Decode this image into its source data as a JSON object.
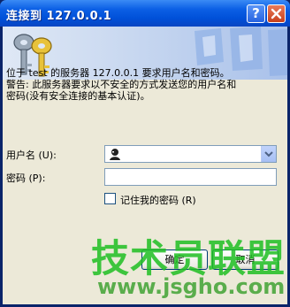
{
  "window": {
    "title": "连接到 127.0.0.1",
    "help_button": "?",
    "close_button": "X"
  },
  "message": {
    "line1": "位于 test 的服务器 127.0.0.1 要求用户名和密码。",
    "line2": "警告: 此服务器要求以不安全的方式发送您的用户名和",
    "line3": "密码(没有安全连接的基本认证)。"
  },
  "form": {
    "username_label": "用户名 (U):",
    "password_label": "密码 (P):",
    "username_value": "",
    "password_value": "",
    "remember_label": "记住我的密码 (R)",
    "remember_checked": false
  },
  "buttons": {
    "ok": "确定",
    "cancel": "取消"
  },
  "watermark": {
    "main": "技术员联盟",
    "sub": "www.jsgho.com"
  },
  "colors": {
    "titlebar": "#0050d8",
    "client_bg": "#ece9d8",
    "watermark_green": "#1fbf23"
  }
}
